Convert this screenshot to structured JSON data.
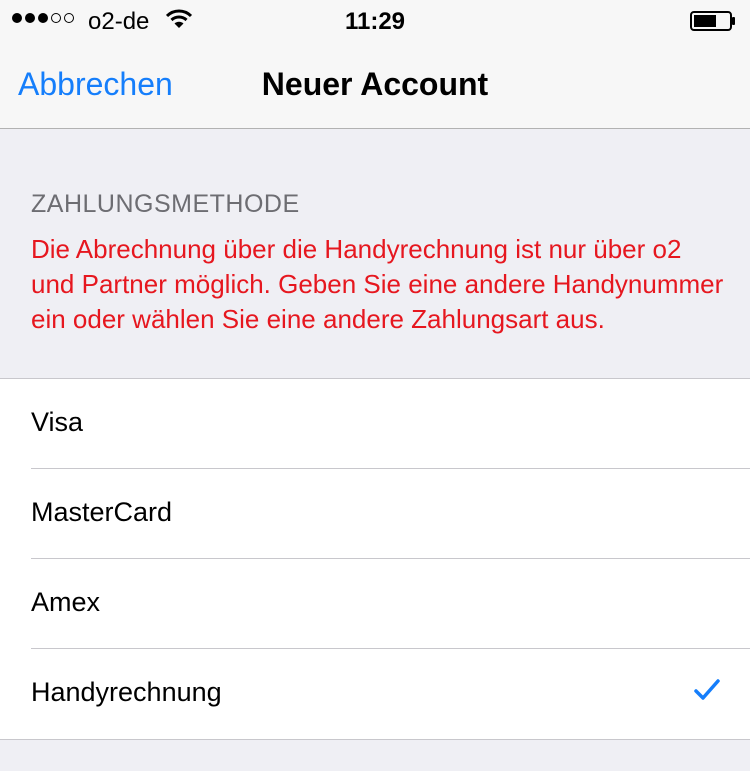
{
  "status_bar": {
    "carrier": "o2-de",
    "time": "11:29",
    "signal_bars_filled": 3,
    "signal_bars_total": 5
  },
  "nav": {
    "cancel_label": "Abbrechen",
    "title": "Neuer Account"
  },
  "section": {
    "header": "ZAHLUNGSMETHODE",
    "error_message": "Die Abrechnung über die Handyrechnung ist nur über o2 und Partner möglich. Geben Sie eine andere Handynummer ein oder wählen Sie eine andere Zahlungsart aus."
  },
  "payment_methods": [
    {
      "label": "Visa",
      "selected": false
    },
    {
      "label": "MasterCard",
      "selected": false
    },
    {
      "label": "Amex",
      "selected": false
    },
    {
      "label": "Handyrechnung",
      "selected": true
    }
  ],
  "colors": {
    "accent": "#157efb",
    "error": "#e6171f",
    "background": "#efeff4"
  },
  "icons": [
    "signal-icon",
    "wifi-icon",
    "battery-icon",
    "checkmark-icon"
  ]
}
